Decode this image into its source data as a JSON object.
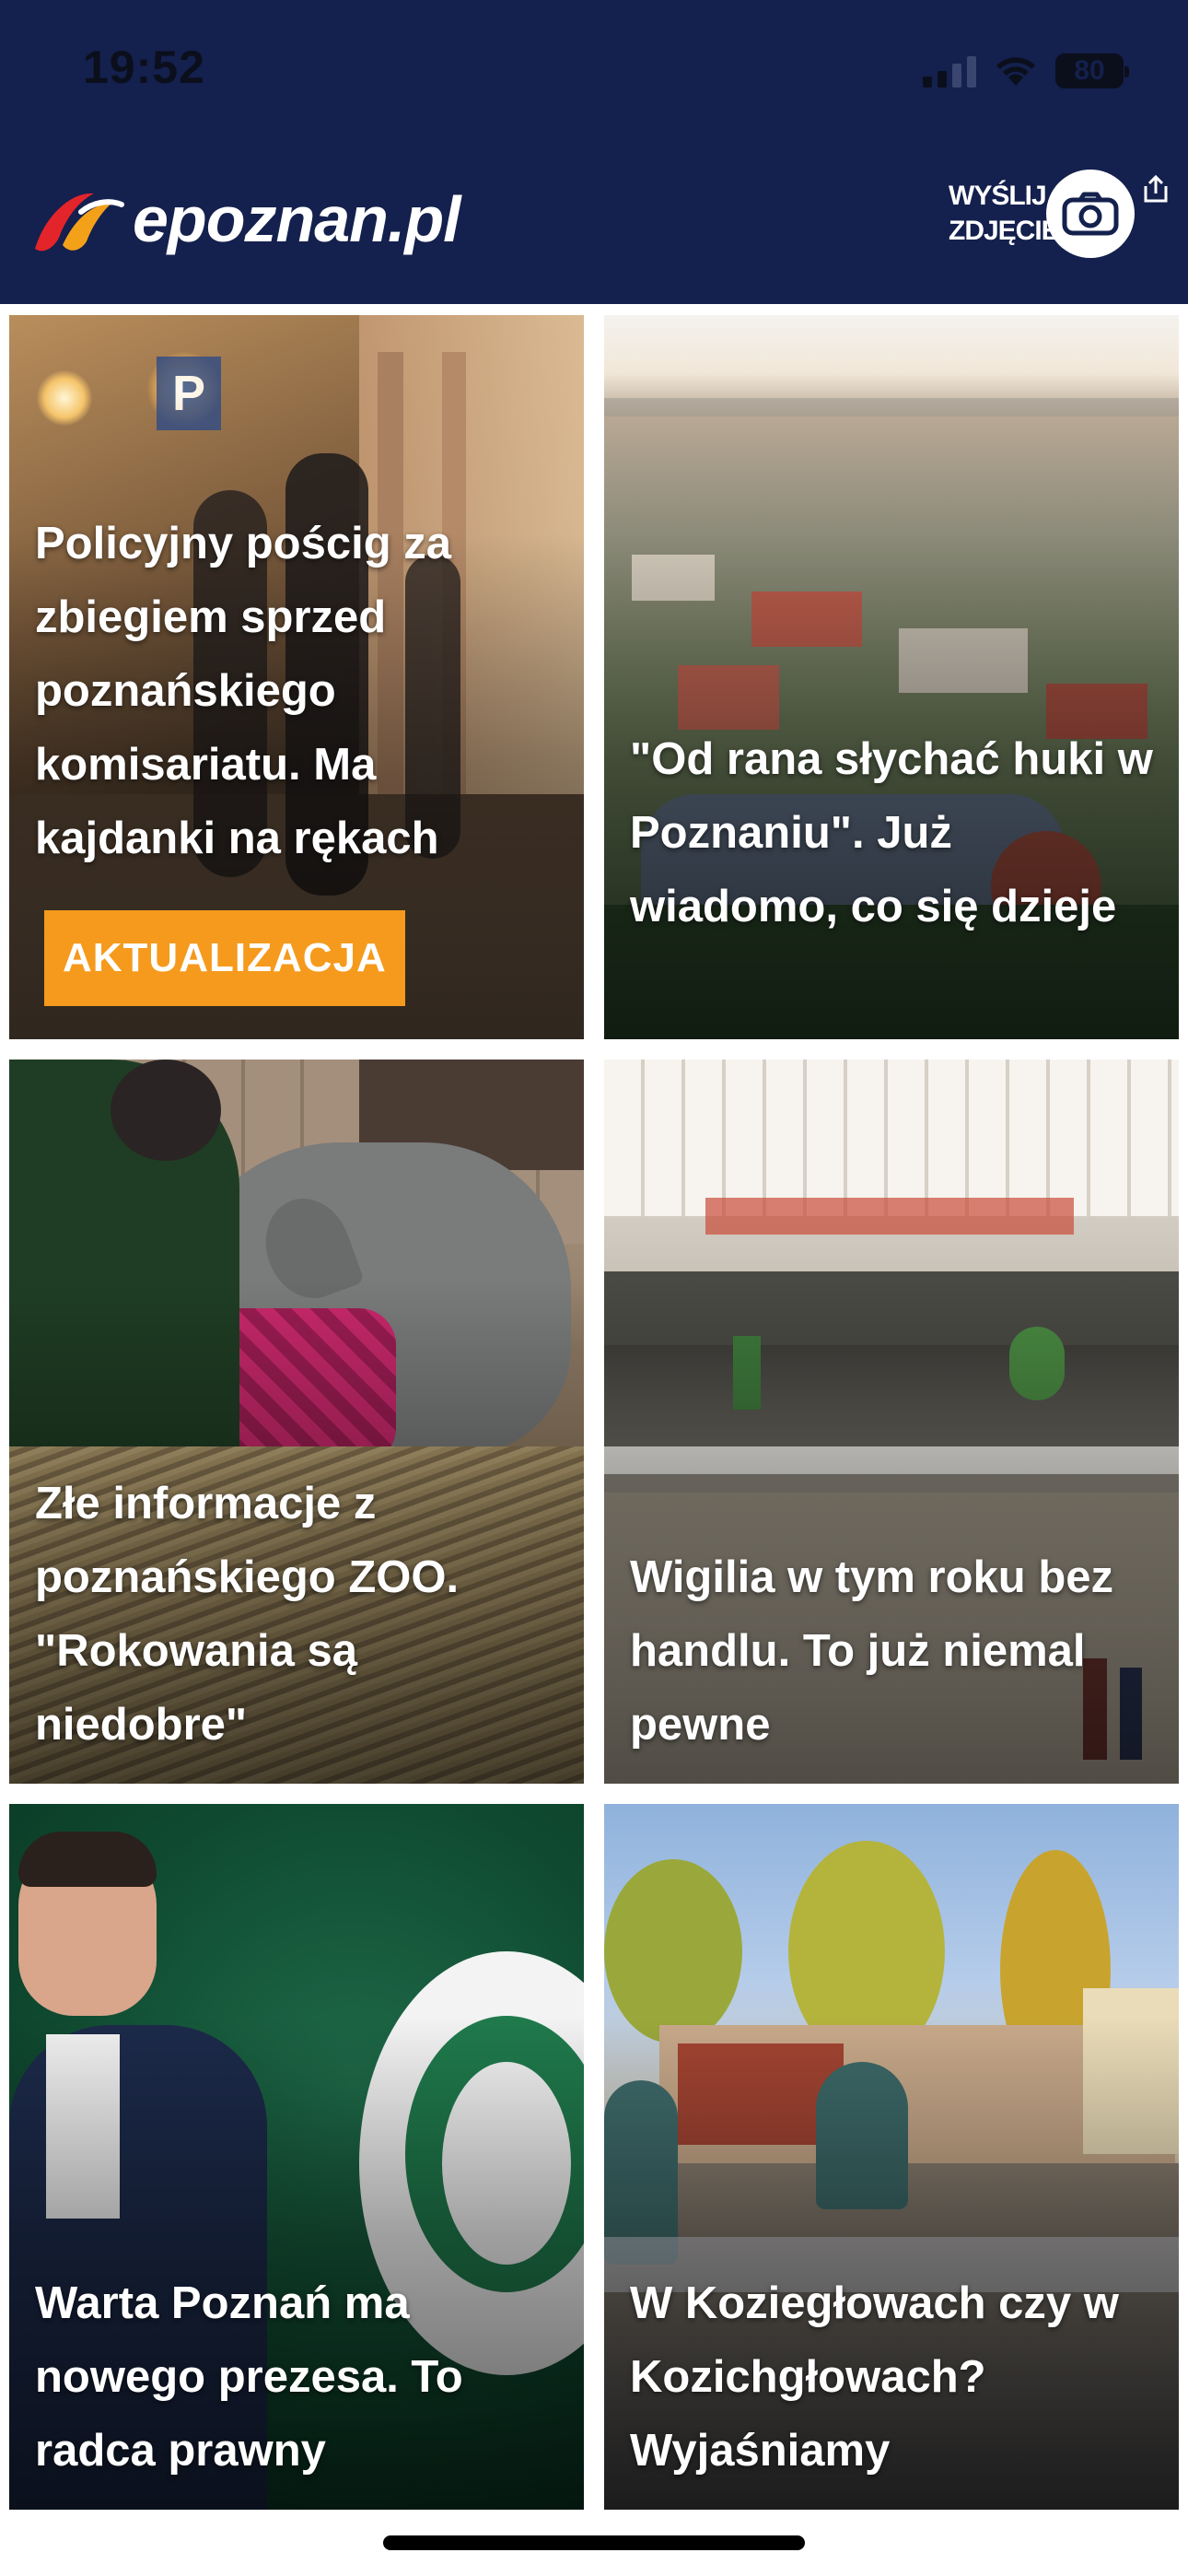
{
  "status_bar": {
    "time": "19:52",
    "battery": "80"
  },
  "header": {
    "logo_text": "epoznan.pl",
    "send_photo_line1": "WYŚLIJ",
    "send_photo_line2": "ZDJĘCIE",
    "icons": [
      "camera-icon",
      "share-icon"
    ]
  },
  "articles": [
    {
      "title": "Policyjny pościg za zbiegiem sprzed poznańskiego komisariatu. Ma kajdanki na rękach",
      "badge": "AKTUALIZACJA"
    },
    {
      "title": "\"Od rana słychać huki w Poznaniu\". Już wiadomo, co się dzieje"
    },
    {
      "title": "Złe informacje z poznańskiego ZOO. \"Rokowania są niedobre\""
    },
    {
      "title": "Wigilia w tym roku bez handlu. To już niemal pewne"
    },
    {
      "title": "Warta Poznań ma nowego prezesa. To radca prawny"
    },
    {
      "title": "W Koziegłowach czy w Kozichgłowach? Wyjaśniamy"
    }
  ],
  "colors": {
    "header_bg": "#14204d",
    "badge_bg": "#f59a1c",
    "logo_red": "#e3242b",
    "logo_orange": "#f4a11a"
  }
}
